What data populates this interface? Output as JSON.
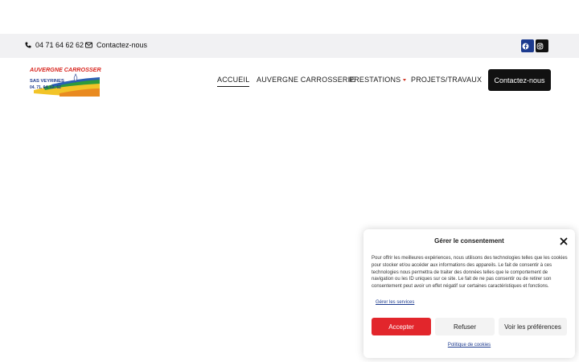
{
  "topbar": {
    "phone": "04 71 64 62 62",
    "contact": "Contactez-nous",
    "social": [
      "facebook-icon",
      "instagram-icon"
    ],
    "social_colors": {
      "facebook": "#1d3b8f",
      "instagram": "#111111"
    }
  },
  "header": {
    "logo": {
      "line1": "AUVERGNE CARROSSERIE",
      "line2": "SAS VEYRINES",
      "line3": "04. 71. 64. 62. 62"
    },
    "nav": [
      {
        "label": "ACCUEIL",
        "active": true
      },
      {
        "label": "AUVERGNE CARROSSERIE"
      },
      {
        "label": "PRESTATIONS",
        "has_dropdown": true
      },
      {
        "label": "PROJETS/TRAVAUX"
      }
    ],
    "cta": "Contactez-nous"
  },
  "consent": {
    "title": "Gérer le consentement",
    "body": "Pour offrir les meilleures expériences, nous utilisons des technologies telles que les cookies pour stocker et/ou accéder aux informations des appareils. Le fait de consentir à ces technologies nous permettra de traiter des données telles que le comportement de navigation ou les ID uniques sur ce site. Le fait de ne pas consentir ou de retirer son consentement peut avoir un effet négatif sur certaines caractéristiques et fonctions.",
    "manage": "Gérer les services",
    "accept": "Accepter",
    "refuse": "Refuser",
    "prefs": "Voir les préférences",
    "policy": "Politique de cookies",
    "accent": "#e2262c"
  }
}
